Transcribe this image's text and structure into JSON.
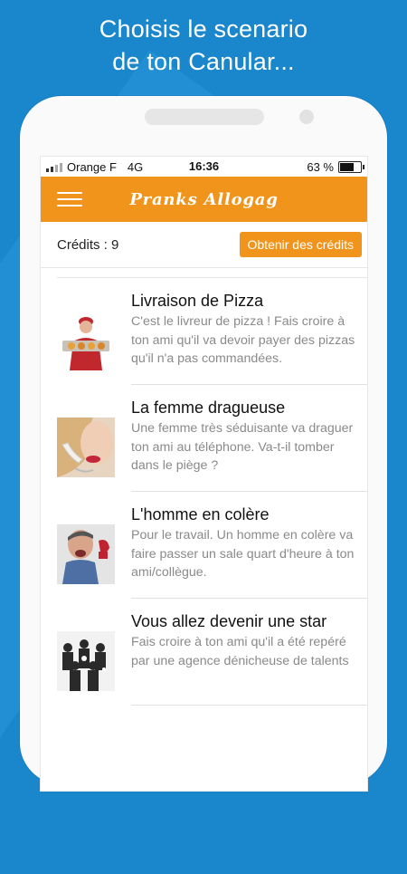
{
  "headline": {
    "line1": "Choisis le scenario",
    "line2": "de ton Canular..."
  },
  "statusbar": {
    "carrier": "Orange F",
    "network": "4G",
    "time": "16:36",
    "battery": "63 %",
    "battery_level": 0.63
  },
  "appbar": {
    "title": "Pranks Allogag",
    "menu_icon": "hamburger-menu-icon"
  },
  "credits": {
    "label": "Crédits : 9",
    "button": "Obtenir des crédits"
  },
  "pranks": [
    {
      "title": "Livraison de Pizza",
      "description": "C'est le livreur de pizza ! Fais croire à ton ami qu'il va devoir payer des pizzas qu'il n'a pas commandées.",
      "image": "pizza-delivery-man"
    },
    {
      "title": "La femme dragueuse",
      "description": "Une femme très séduisante va draguer ton ami au téléphone. Va-t-il tomber dans le piège ?",
      "image": "woman-on-phone"
    },
    {
      "title": "L'homme en colère",
      "description": "Pour le travail. Un homme en colère va faire passer un sale quart d'heure à ton ami/collègue.",
      "image": "angry-man-on-phone"
    },
    {
      "title": "Vous allez devenir une star",
      "description": "Fais croire à ton ami qu'il a été repéré par une agence dénicheuse de talents",
      "image": "star-crowd"
    }
  ],
  "colors": {
    "accent": "#f0941c",
    "background": "#1a86cc"
  }
}
